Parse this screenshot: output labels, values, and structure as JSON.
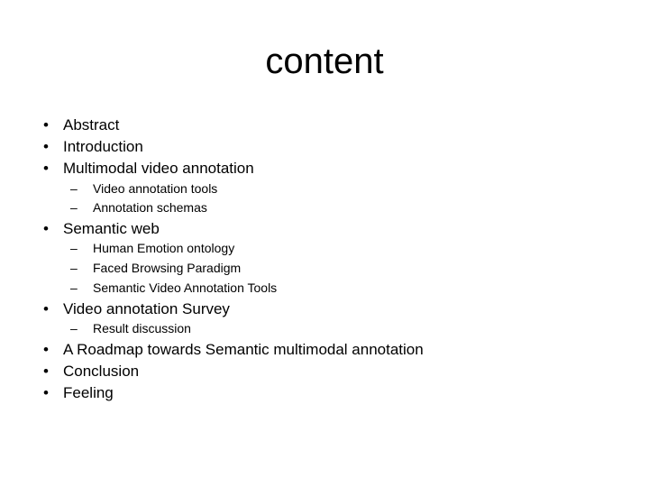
{
  "slide": {
    "title": "content",
    "items": [
      {
        "level": 1,
        "marker": "•",
        "text": "Abstract"
      },
      {
        "level": 1,
        "marker": "•",
        "text": "Introduction"
      },
      {
        "level": 1,
        "marker": "•",
        "text": "Multimodal video annotation"
      },
      {
        "level": 2,
        "marker": "–",
        "text": "Video annotation tools"
      },
      {
        "level": 2,
        "marker": "–",
        "text": "Annotation schemas"
      },
      {
        "level": 1,
        "marker": "•",
        "text": "Semantic web"
      },
      {
        "level": 2,
        "marker": "–",
        "text": "Human Emotion ontology"
      },
      {
        "level": 2,
        "marker": "–",
        "text": "Faced Browsing Paradigm"
      },
      {
        "level": 2,
        "marker": "–",
        "text": "Semantic Video Annotation Tools"
      },
      {
        "level": 1,
        "marker": "•",
        "text": "Video annotation Survey"
      },
      {
        "level": 2,
        "marker": "–",
        "text": "Result discussion"
      },
      {
        "level": 1,
        "marker": "•",
        "text": "A Roadmap towards Semantic multimodal annotation"
      },
      {
        "level": 1,
        "marker": "•",
        "text": "Conclusion"
      },
      {
        "level": 1,
        "marker": "•",
        "text": "Feeling"
      }
    ]
  }
}
